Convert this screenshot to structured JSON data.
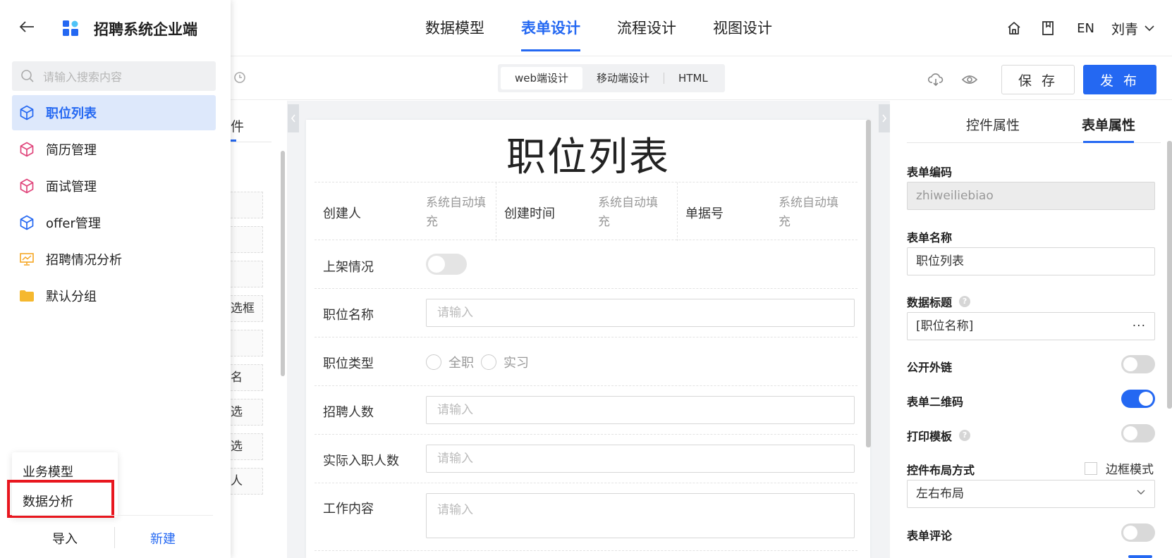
{
  "colors": {
    "accent": "#2468f2",
    "highlight": "#e8161e"
  },
  "top_nav": {
    "tabs": [
      {
        "label": "数据模型"
      },
      {
        "label": "表单设计"
      },
      {
        "label": "流程设计"
      },
      {
        "label": "视图设计"
      }
    ],
    "active_tab": "表单设计",
    "lang": "EN",
    "user": "刘青",
    "icons": [
      "home-icon",
      "bookmark-icon",
      "chevron-down-icon"
    ]
  },
  "toolbar": {
    "device_tabs": [
      "web端设计",
      "移动端设计",
      "HTML"
    ],
    "active_device": "web端设计",
    "save_label": "保 存",
    "publish_label": "发 布",
    "icons": [
      "history-icon",
      "cloud-download-icon",
      "eye-icon"
    ]
  },
  "sidebar": {
    "title": "招聘系统企业端",
    "search_placeholder": "请输入搜索内容",
    "items": [
      {
        "label": "职位列表",
        "icon": "cube-icon",
        "icon_color": "#2468f2",
        "active": true
      },
      {
        "label": "简历管理",
        "icon": "cube-icon",
        "icon_color": "#e0457b"
      },
      {
        "label": "面试管理",
        "icon": "cube-icon",
        "icon_color": "#e0457b"
      },
      {
        "label": "offer管理",
        "icon": "cube-icon",
        "icon_color": "#2468f2"
      },
      {
        "label": "招聘情况分析",
        "icon": "chart-board-icon",
        "icon_color": "#f5a623"
      },
      {
        "label": "默认分组",
        "icon": "folder-icon",
        "icon_color": "#f5b82e"
      }
    ],
    "popup_items": [
      "业务模型",
      "数据分析"
    ],
    "import_label": "导入",
    "new_label": "新建"
  },
  "component_panel": {
    "tab_fragment": "件",
    "items": [
      "",
      "",
      "",
      "选框",
      "",
      "名",
      "选",
      "选",
      "人"
    ]
  },
  "form": {
    "title": "职位列表",
    "system_fields": [
      {
        "label": "创建人",
        "value": "系统自动填充"
      },
      {
        "label": "创建时间",
        "value": "系统自动填充"
      },
      {
        "label": "单据号",
        "value": "系统自动填充"
      }
    ],
    "fields": {
      "listing_status": {
        "label": "上架情况"
      },
      "position_name": {
        "label": "职位名称",
        "placeholder": "请输入"
      },
      "position_type": {
        "label": "职位类型",
        "options": [
          "全职",
          "实习"
        ]
      },
      "hiring_count": {
        "label": "招聘人数",
        "placeholder": "请输入"
      },
      "actual_hires": {
        "label": "实际入职人数",
        "placeholder": "请输入"
      },
      "job_content": {
        "label": "工作内容",
        "placeholder": "请输入"
      }
    }
  },
  "properties": {
    "tabs": [
      "控件属性",
      "表单属性"
    ],
    "active_tab": "表单属性",
    "form_code_label": "表单编码",
    "form_code_value": "zhiweiliebiao",
    "form_name_label": "表单名称",
    "form_name_value": "职位列表",
    "data_title_label": "数据标题",
    "data_title_value": "[职位名称]",
    "data_title_more": "···",
    "public_link_label": "公开外链",
    "public_link_on": false,
    "qr_code_label": "表单二维码",
    "qr_code_on": true,
    "print_template_label": "打印模板",
    "print_template_on": false,
    "layout_label": "控件布局方式",
    "border_mode_label": "边框模式",
    "layout_value": "左右布局",
    "comment_label": "表单评论",
    "comment_on": false,
    "help_glyph": "?"
  }
}
